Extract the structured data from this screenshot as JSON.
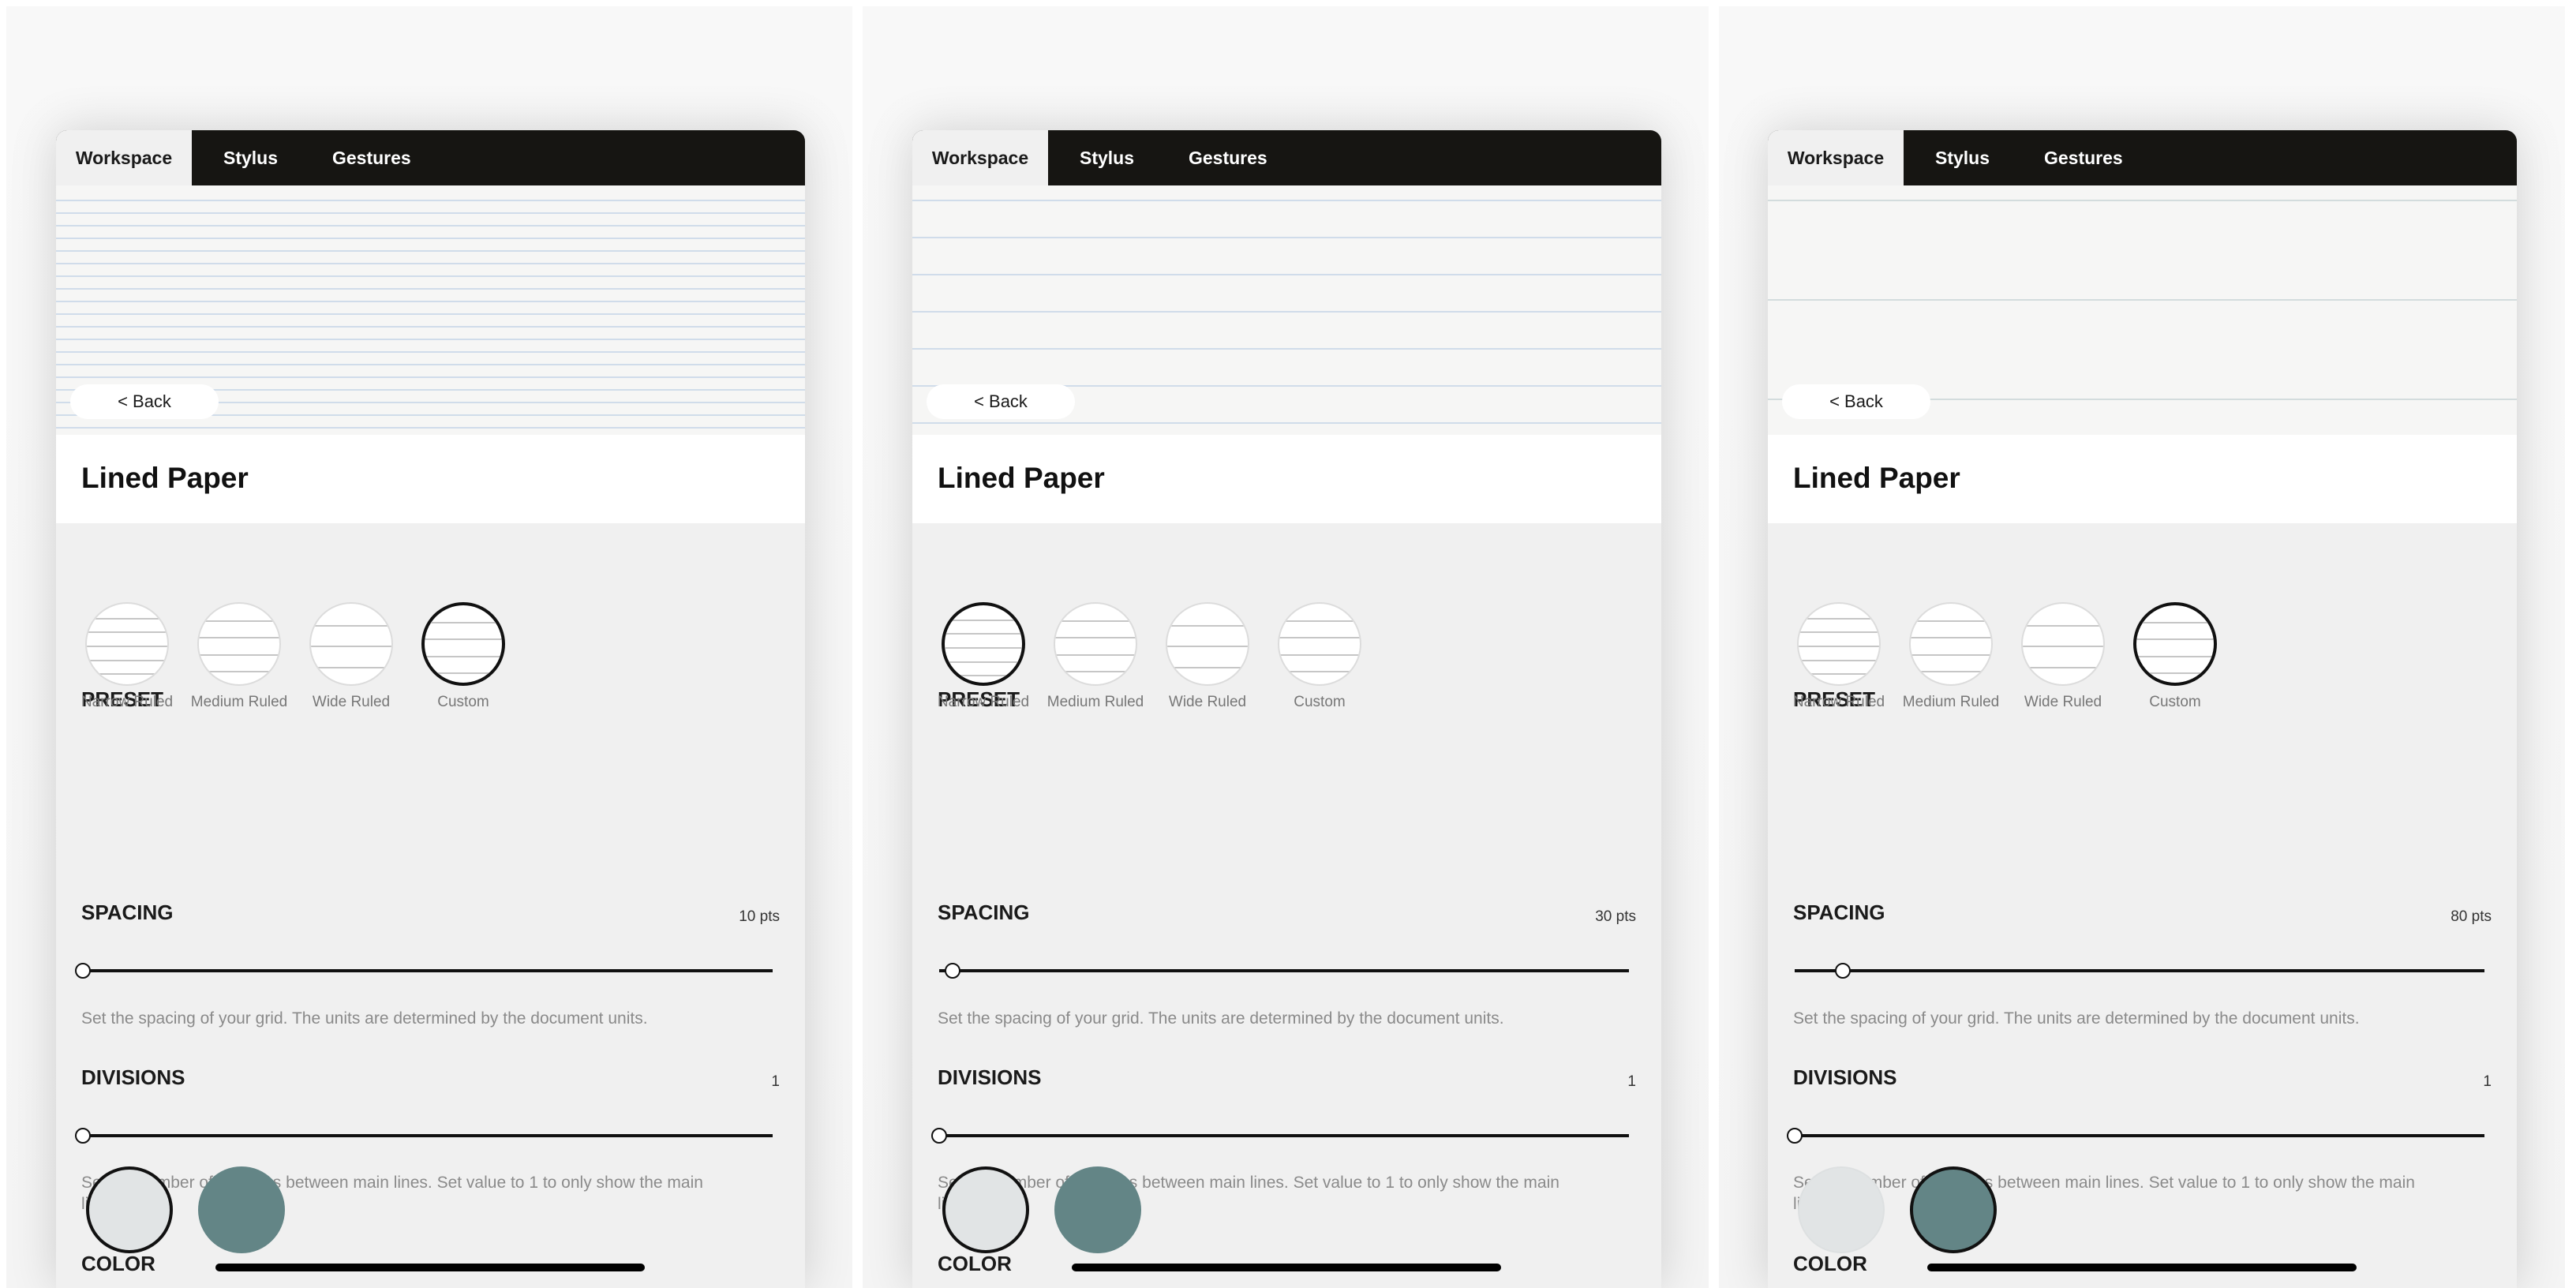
{
  "screens": [
    {
      "tabs": [
        {
          "label": "Workspace",
          "active": true
        },
        {
          "label": "Stylus",
          "active": false
        },
        {
          "label": "Gestures",
          "active": false
        }
      ],
      "back_label": "< Back",
      "title": "Lined Paper",
      "preview_line_spacing_pts": 10,
      "preset": {
        "label": "PRESET",
        "selected": "Custom",
        "options": [
          {
            "label": "Narrow Ruled",
            "lines": 5
          },
          {
            "label": "Medium Ruled",
            "lines": 4
          },
          {
            "label": "Wide Ruled",
            "lines": 3
          },
          {
            "label": "Custom",
            "lines": 4
          }
        ]
      },
      "spacing": {
        "label": "SPACING",
        "value_text": "10 pts",
        "value": 10,
        "fraction": 0.0,
        "description": "Set the spacing of your grid. The units are determined by the document units."
      },
      "divisions": {
        "label": "DIVISIONS",
        "value_text": "1",
        "value": 1,
        "fraction": 0.0,
        "description": "Set the number of divisions between main lines. Set value to 1 to only show the main lines."
      },
      "color": {
        "label": "COLOR",
        "selected_index": 0,
        "swatches": [
          {
            "name": "light-gray",
            "hex": "#e1e4e5"
          },
          {
            "name": "teal",
            "hex": "#638586"
          }
        ]
      }
    },
    {
      "tabs": [
        {
          "label": "Workspace",
          "active": true
        },
        {
          "label": "Stylus",
          "active": false
        },
        {
          "label": "Gestures",
          "active": false
        }
      ],
      "back_label": "< Back",
      "title": "Lined Paper",
      "preview_line_spacing_pts": 30,
      "preset": {
        "label": "PRESET",
        "selected": "Narrow Ruled",
        "options": [
          {
            "label": "Narrow Ruled",
            "lines": 5
          },
          {
            "label": "Medium Ruled",
            "lines": 4
          },
          {
            "label": "Wide Ruled",
            "lines": 3
          },
          {
            "label": "Custom",
            "lines": 4
          }
        ]
      },
      "spacing": {
        "label": "SPACING",
        "value_text": "30 pts",
        "value": 30,
        "fraction": 0.02,
        "description": "Set the spacing of your grid. The units are determined by the document units."
      },
      "divisions": {
        "label": "DIVISIONS",
        "value_text": "1",
        "value": 1,
        "fraction": 0.0,
        "description": "Set the number of divisions between main lines. Set value to 1 to only show the main lines."
      },
      "color": {
        "label": "COLOR",
        "selected_index": 0,
        "swatches": [
          {
            "name": "light-gray",
            "hex": "#e1e4e5"
          },
          {
            "name": "teal",
            "hex": "#638586"
          }
        ]
      }
    },
    {
      "tabs": [
        {
          "label": "Workspace",
          "active": true
        },
        {
          "label": "Stylus",
          "active": false
        },
        {
          "label": "Gestures",
          "active": false
        }
      ],
      "back_label": "< Back",
      "title": "Lined Paper",
      "preview_line_spacing_pts": 80,
      "preset": {
        "label": "PRESET",
        "selected": "Custom",
        "options": [
          {
            "label": "Narrow Ruled",
            "lines": 5
          },
          {
            "label": "Medium Ruled",
            "lines": 4
          },
          {
            "label": "Wide Ruled",
            "lines": 3
          },
          {
            "label": "Custom",
            "lines": 4
          }
        ]
      },
      "spacing": {
        "label": "SPACING",
        "value_text": "80 pts",
        "value": 80,
        "fraction": 0.07,
        "description": "Set the spacing of your grid. The units are determined by the document units."
      },
      "divisions": {
        "label": "DIVISIONS",
        "value_text": "1",
        "value": 1,
        "fraction": 0.0,
        "description": "Set the number of divisions between main lines. Set value to 1 to only show the main lines."
      },
      "color": {
        "label": "COLOR",
        "selected_index": 1,
        "swatches": [
          {
            "name": "light-gray",
            "hex": "#e1e4e5"
          },
          {
            "name": "teal",
            "hex": "#638586"
          }
        ]
      }
    }
  ]
}
